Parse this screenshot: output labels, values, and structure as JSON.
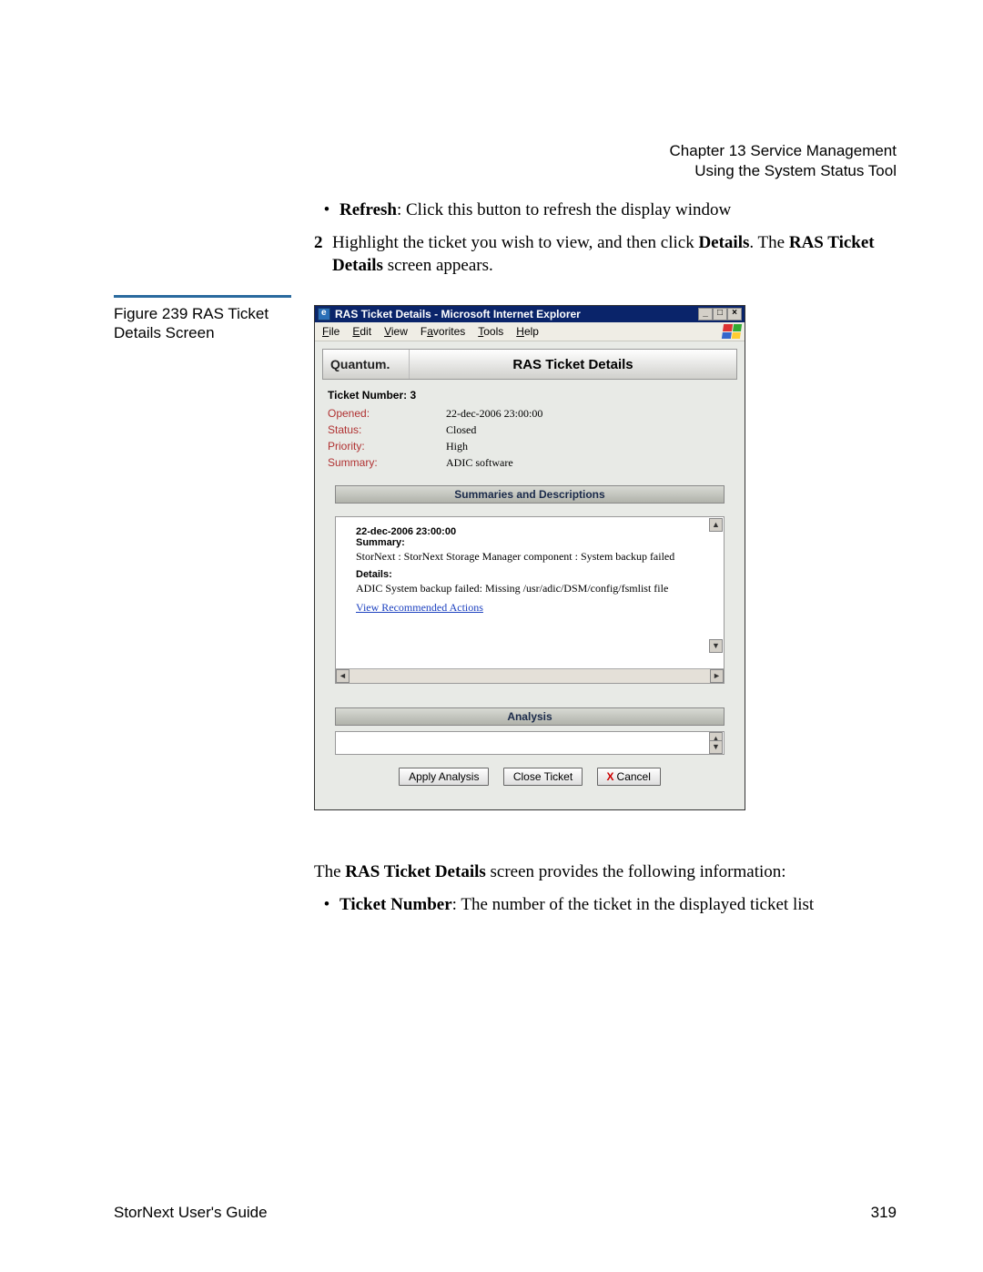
{
  "header": {
    "chapter": "Chapter 13  Service Management",
    "section": "Using the System Status Tool"
  },
  "intro": {
    "refresh_bullet_bold": "Refresh",
    "refresh_bullet_rest": ": Click this button to refresh the display window",
    "step_num": "2",
    "step_text_pre": "Highlight the ticket you wish to view, and then click ",
    "step_details": "Details",
    "step_text_mid": ". The ",
    "step_ras": "RAS Ticket Details",
    "step_text_end": " screen appears."
  },
  "figure": {
    "caption": "Figure 239  RAS Ticket Details Screen"
  },
  "window": {
    "title": "RAS Ticket Details - Microsoft Internet Explorer",
    "menus": [
      "File",
      "Edit",
      "View",
      "Favorites",
      "Tools",
      "Help"
    ],
    "brand": "Quantum.",
    "page_title": "RAS Ticket Details",
    "ticket_number_label": "Ticket Number: 3",
    "fields": {
      "opened_label": "Opened:",
      "opened_val": "22-dec-2006 23:00:00",
      "status_label": "Status:",
      "status_val": "Closed",
      "priority_label": "Priority:",
      "priority_val": "High",
      "summary_label": "Summary:",
      "summary_val": "ADIC software"
    },
    "summaries_bar": "Summaries and Descriptions",
    "entry": {
      "timestamp": "22-dec-2006 23:00:00",
      "summary_hdr": "Summary:",
      "summary_txt": "StorNext : StorNext Storage Manager component : System backup failed",
      "details_hdr": "Details:",
      "details_txt": "ADIC System backup failed: Missing /usr/adic/DSM/config/fsmlist file",
      "link": "View Recommended Actions"
    },
    "analysis_bar": "Analysis",
    "buttons": {
      "apply": "Apply Analysis",
      "close": "Close Ticket",
      "cancel": "Cancel"
    }
  },
  "after": {
    "line1_pre": "The ",
    "line1_bold": "RAS Ticket Details",
    "line1_post": " screen provides the following information:",
    "bullet_bold": "Ticket Number",
    "bullet_rest": ": The number of the ticket in the displayed ticket list"
  },
  "footer": {
    "left": "StorNext User's Guide",
    "right": "319"
  }
}
